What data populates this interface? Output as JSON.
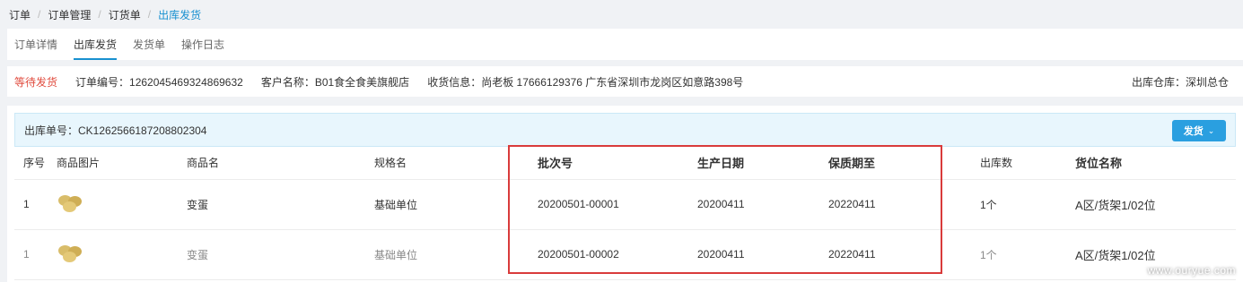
{
  "breadcrumb": [
    "订单",
    "订单管理",
    "订货单",
    "出库发货"
  ],
  "tabs": [
    "订单详情",
    "出库发货",
    "发货单",
    "操作日志"
  ],
  "info": {
    "status": "等待发货",
    "order_no": "订单编号：1262045469324869632",
    "customer": "客户名称：B01食全食美旗舰店",
    "shipping": "收货信息：尚老板 17666129376 广东省深圳市龙岗区如意路398号",
    "warehouse": "出库仓库：深圳总仓"
  },
  "panel": {
    "outbound_no": "出库单号：CK1262566187208802304",
    "ship_button": "发货",
    "columns": [
      "序号",
      "商品图片",
      "商品名",
      "规格名",
      "批次号",
      "生产日期",
      "保质期至",
      "出库数",
      "货位名称"
    ],
    "rows": [
      {
        "index": "1",
        "name": "变蛋",
        "spec": "基础单位",
        "batch": "20200501-00001",
        "mfg_date": "20200411",
        "expiry": "20220411",
        "qty": "1个",
        "location": "A区/货架1/02位"
      },
      {
        "index": "1",
        "name": "变蛋",
        "spec": "基础单位",
        "batch": "20200501-00002",
        "mfg_date": "20200411",
        "expiry": "20220411",
        "qty": "1个",
        "location": "A区/货架1/02位"
      }
    ]
  },
  "watermark": "www.ouryue.com",
  "colors": {
    "accent": "#1890d0",
    "status": "#e04b3e",
    "highlight": "#d93b3b",
    "button": "#2a9fe0"
  }
}
